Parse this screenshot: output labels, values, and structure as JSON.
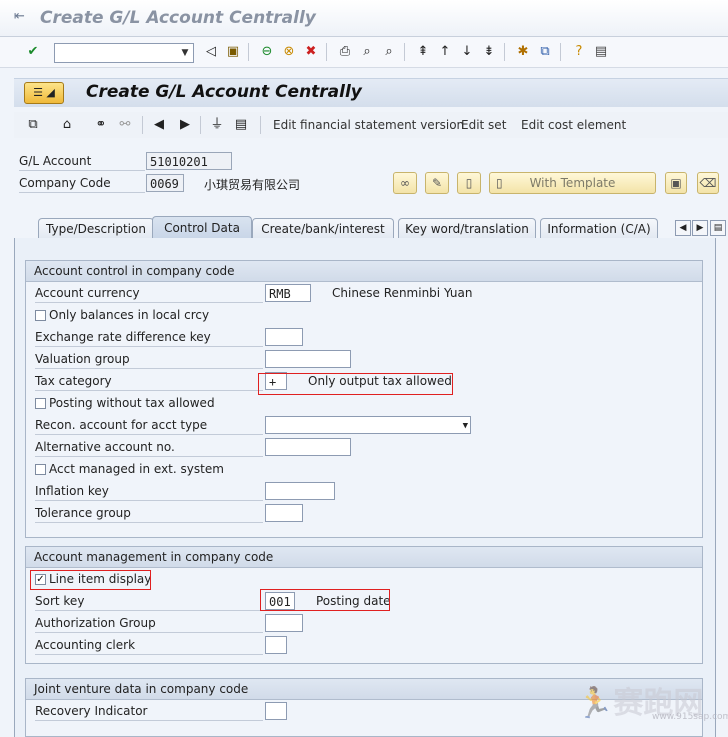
{
  "window": {
    "title": "Create G/L Account Centrally"
  },
  "toolbar": {
    "command_field_value": ""
  },
  "app": {
    "title": "Create G/L Account Centrally",
    "buttons": {
      "edit_fs_version": "Edit financial statement version",
      "edit_set": "Edit set",
      "edit_cost_element": "Edit cost element",
      "with_template": "With Template"
    }
  },
  "header": {
    "gl_account_label": "G/L Account",
    "gl_account_value": "51010201",
    "company_code_label": "Company Code",
    "company_code_value": "0069",
    "company_name": "小琪贸易有限公司"
  },
  "tabs": [
    {
      "label": "Type/Description"
    },
    {
      "label": "Control Data"
    },
    {
      "label": "Create/bank/interest"
    },
    {
      "label": "Key word/translation"
    },
    {
      "label": "Information (C/A)"
    }
  ],
  "account_control": {
    "title": "Account control in company code",
    "account_currency_label": "Account currency",
    "account_currency_value": "RMB",
    "account_currency_desc": "Chinese Renminbi Yuan",
    "only_balances_label": "Only balances in local crcy",
    "exchange_rate_label": "Exchange rate difference key",
    "valuation_group_label": "Valuation group",
    "tax_category_label": "Tax category",
    "tax_category_value": "+",
    "tax_category_desc": "Only output tax allowed",
    "posting_without_tax_label": "Posting without tax allowed",
    "recon_account_label": "Recon. account for acct type",
    "alt_account_label": "Alternative account no.",
    "acct_managed_ext_label": "Acct managed in ext. system",
    "inflation_key_label": "Inflation key",
    "tolerance_group_label": "Tolerance group"
  },
  "account_mgmt": {
    "title": "Account management in company code",
    "line_item_display_label": "Line item display",
    "line_item_display_checked": true,
    "sort_key_label": "Sort key",
    "sort_key_value": "001",
    "sort_key_desc": "Posting date",
    "authorization_group_label": "Authorization Group",
    "accounting_clerk_label": "Accounting clerk"
  },
  "joint_venture": {
    "title": "Joint venture data in company code",
    "recovery_indicator_label": "Recovery Indicator"
  },
  "watermark": {
    "text": "赛跑网",
    "url": "www.915sap.com"
  }
}
